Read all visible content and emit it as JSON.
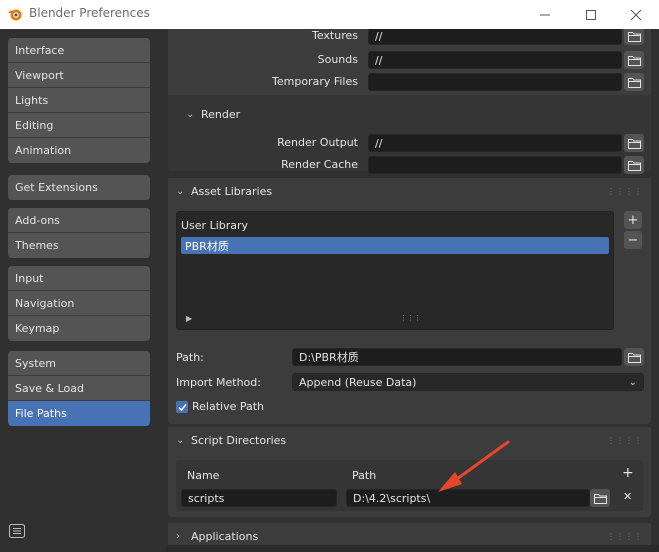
{
  "window": {
    "title": "Blender Preferences",
    "minimize_glyph": "—",
    "maximize_glyph": "☐",
    "close_glyph": "✕"
  },
  "sidebar": {
    "groups": [
      [
        "Interface",
        "Viewport",
        "Lights",
        "Editing",
        "Animation"
      ],
      [
        "Get Extensions"
      ],
      [
        "Add-ons",
        "Themes"
      ],
      [
        "Input",
        "Navigation",
        "Keymap"
      ],
      [
        "System",
        "Save & Load",
        "File Paths"
      ]
    ],
    "active": "File Paths"
  },
  "data_paths": {
    "textures_label": "Textures",
    "textures_value": "//",
    "sounds_label": "Sounds",
    "sounds_value": "//",
    "temp_label": "Temporary Files",
    "temp_value": ""
  },
  "render": {
    "header": "Render",
    "output_label": "Render Output",
    "output_value": "//",
    "cache_label": "Render Cache",
    "cache_value": ""
  },
  "asset_libraries": {
    "header": "Asset Libraries",
    "items": [
      "User Library",
      "PBR材质"
    ],
    "selected": "PBR材质",
    "add_glyph": "+",
    "remove_glyph": "−",
    "path_label": "Path:",
    "path_value": "D:\\PBR材质",
    "import_label": "Import Method:",
    "import_value": "Append (Reuse Data)",
    "relative_label": "Relative Path",
    "relative_checked": true
  },
  "script_directories": {
    "header": "Script Directories",
    "col_name": "Name",
    "col_path": "Path",
    "add_glyph": "+",
    "remove_glyph": "✕",
    "rows": [
      {
        "name": "scripts",
        "path": "D:\\4.2\\scripts\\"
      }
    ]
  },
  "applications": {
    "header": "Applications"
  },
  "colors": {
    "accent": "#4772b3",
    "annotation_arrow": "#e8462a"
  }
}
